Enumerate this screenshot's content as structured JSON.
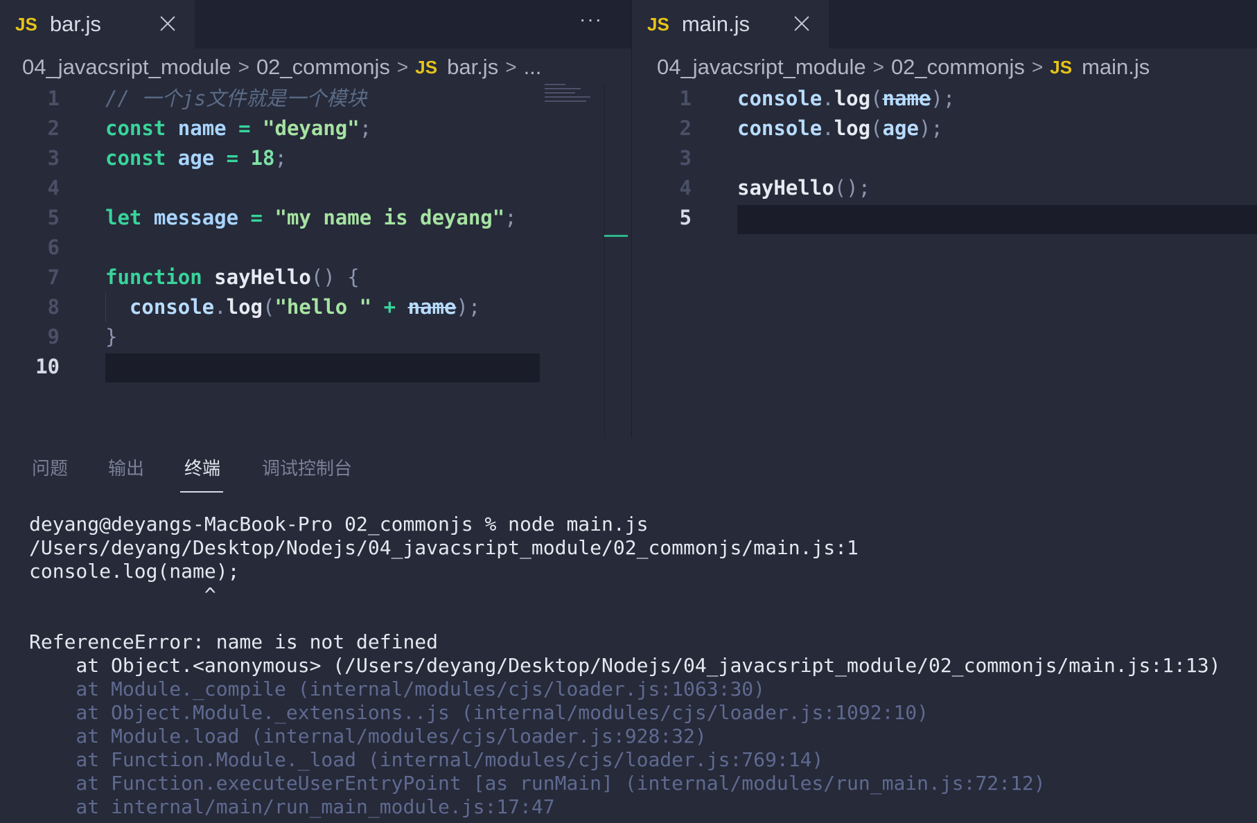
{
  "left_editor": {
    "tab": {
      "badge": "JS",
      "name": "bar.js"
    },
    "more_actions": "···",
    "breadcrumb": [
      "04_javacsript_module",
      "02_commonjs",
      "bar.js",
      "..."
    ],
    "breadcrumb_badge": "JS",
    "line_numbers": [
      "1",
      "2",
      "3",
      "4",
      "5",
      "6",
      "7",
      "8",
      "9",
      "10"
    ],
    "active_line": "10",
    "code": {
      "l1": "// 一个js文件就是一个模块",
      "l2": {
        "kw": "const",
        "var": "name",
        "op": "=",
        "str": "\"deyang\"",
        "end": ";"
      },
      "l3": {
        "kw": "const",
        "var": "age",
        "op": "=",
        "num": "18",
        "end": ";"
      },
      "l5": {
        "kw": "let",
        "var": "message",
        "op": "=",
        "str": "\"my name is deyang\"",
        "end": ";"
      },
      "l7": {
        "kw": "function",
        "fn": "sayHello",
        "paren": "()",
        "brace": "{"
      },
      "l8": {
        "obj": "console",
        "dot": ".",
        "method": "log",
        "open": "(",
        "str": "\"hello \"",
        "op": "+",
        "var": "name",
        "close": ");"
      },
      "l9": {
        "brace": "}"
      }
    }
  },
  "right_editor": {
    "tab": {
      "badge": "JS",
      "name": "main.js"
    },
    "breadcrumb": [
      "04_javacsript_module",
      "02_commonjs",
      "main.js"
    ],
    "breadcrumb_badge": "JS",
    "line_numbers": [
      "1",
      "2",
      "3",
      "4",
      "5"
    ],
    "active_line": "5",
    "code": {
      "l1": {
        "obj": "console",
        "dot": ".",
        "method": "log",
        "open": "(",
        "var": "name",
        "close": ");"
      },
      "l2": {
        "obj": "console",
        "dot": ".",
        "method": "log",
        "open": "(",
        "var": "age",
        "close": ");"
      },
      "l4": {
        "fn": "sayHello",
        "paren": "();"
      }
    }
  },
  "panel": {
    "tabs": [
      "问题",
      "输出",
      "终端",
      "调试控制台"
    ],
    "active_tab": "终端"
  },
  "terminal": {
    "lines": [
      "deyang@deyangs-MacBook-Pro 02_commonjs % node main.js",
      "/Users/deyang/Desktop/Nodejs/04_javacsript_module/02_commonjs/main.js:1",
      "console.log(name);",
      "               ^",
      "",
      "ReferenceError: name is not defined",
      "    at Object.<anonymous> (/Users/deyang/Desktop/Nodejs/04_javacsript_module/02_commonjs/main.js:1:13)"
    ],
    "dim_lines": [
      "    at Module._compile (internal/modules/cjs/loader.js:1063:30)",
      "    at Object.Module._extensions..js (internal/modules/cjs/loader.js:1092:10)",
      "    at Module.load (internal/modules/cjs/loader.js:928:32)",
      "    at Function.Module._load (internal/modules/cjs/loader.js:769:14)",
      "    at Function.executeUserEntryPoint [as runMain] (internal/modules/run_main.js:72:12)",
      "    at internal/main/run_main_module.js:17:47"
    ]
  },
  "colors": {
    "background": "#262a39",
    "keyword": "#38d49a",
    "js_badge": "#e6c419",
    "variable": "#a9d5ff"
  }
}
